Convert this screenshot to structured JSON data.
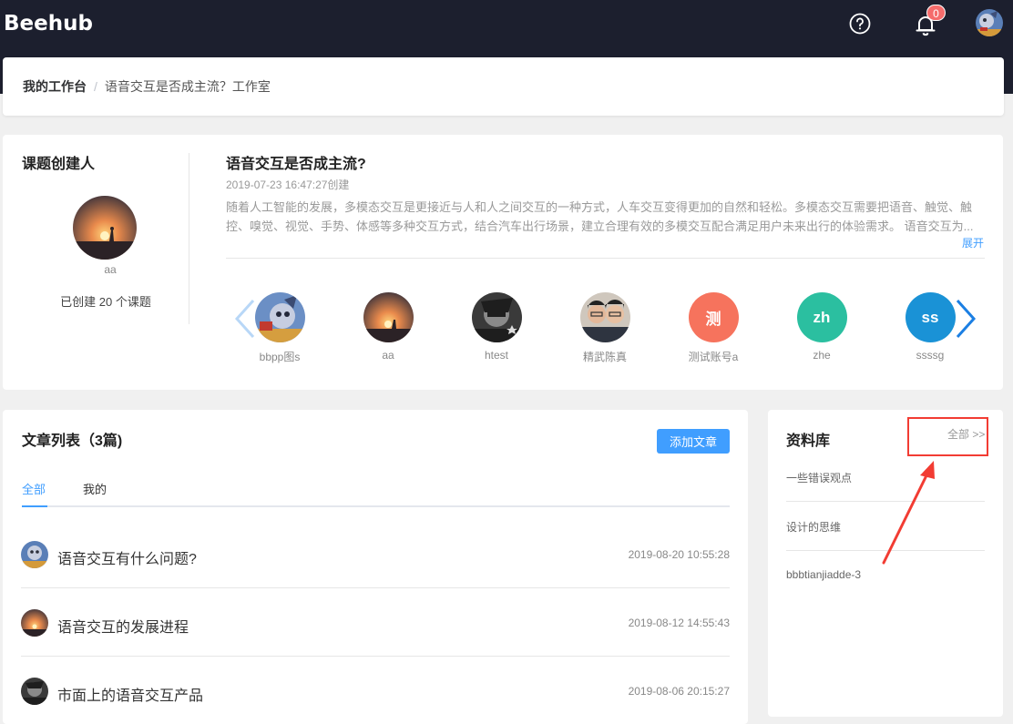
{
  "app": {
    "logo": "Beehub"
  },
  "header": {
    "notification_count": "0",
    "icons": [
      "help-circle-icon",
      "bell-icon",
      "user-avatar"
    ]
  },
  "breadcrumb": {
    "home": "我的工作台",
    "separator": "/",
    "current": "语音交互是否成主流？工作室"
  },
  "creator": {
    "heading": "课题创建人",
    "name": "aa",
    "count_text": "已创建 20 个课题"
  },
  "topic": {
    "title": "语音交互是否成主流?",
    "date": "2019-07-23 16:47:27创建",
    "description": "随着人工智能的发展，多模态交互是更接近与人和人之间交互的一种方式，人车交互变得更加的自然和轻松。多模态交互需要把语音、触觉、触控、嗅觉、视觉、手势、体感等多种交互方式，结合汽车出行场景，建立合理有效的多模交互配合满足用户未来出行的体验需求。 语音交互为...",
    "expand": "展开"
  },
  "members": [
    {
      "name": "bbpp图s",
      "avatar": "photo-cartoon"
    },
    {
      "name": "aa",
      "avatar": "photo-sunset"
    },
    {
      "name": "htest",
      "avatar": "photo-dark"
    },
    {
      "name": "精武陈真",
      "avatar": "photo-people"
    },
    {
      "name": "测试账号a",
      "avatar_text": "测",
      "color": "#f6735d"
    },
    {
      "name": "zhe",
      "avatar_text": "zh",
      "color": "#2bbfa0"
    },
    {
      "name": "ssssg",
      "avatar_text": "ss",
      "color": "#1a92d6"
    }
  ],
  "articles": {
    "heading": "文章列表（3篇)",
    "add_button": "添加文章",
    "tabs": [
      "全部",
      "我的"
    ],
    "items": [
      {
        "title": "语音交互有什么问题?",
        "time": "2019-08-20 10:55:28",
        "avatar": "photo-cartoon"
      },
      {
        "title": "语音交互的发展进程",
        "time": "2019-08-12 14:55:43",
        "avatar": "photo-sunset"
      },
      {
        "title": "市面上的语音交互产品",
        "time": "2019-08-06 20:15:27",
        "avatar": "photo-dark"
      }
    ]
  },
  "library": {
    "heading": "资料库",
    "all_link": "全部 >>",
    "items": [
      "一些错误观点",
      "设计的思维",
      "bbbtianjiadde-3"
    ]
  },
  "colors": {
    "header_bg": "#1c1f2e",
    "accent": "#409eff",
    "badge": "#f56c6c",
    "annotation": "#f23c33"
  }
}
